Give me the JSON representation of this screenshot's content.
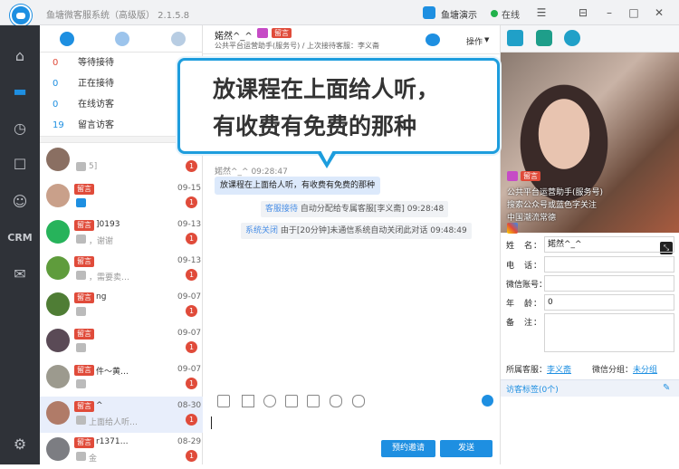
{
  "app": {
    "title": "鱼塘微客服系统（高级版） 2.1.5.8",
    "account": "鱼塘演示",
    "status": "在线"
  },
  "nav": {
    "items": [
      "home-icon",
      "chat-icon",
      "clock-icon",
      "message-icon",
      "user-icon",
      "CRM",
      "mail-icon",
      "settings-icon"
    ]
  },
  "queue": {
    "rows": [
      {
        "count": "0",
        "label": "等待接待"
      },
      {
        "count": "0",
        "label": "正在接待"
      },
      {
        "count": "0",
        "label": "在线访客"
      },
      {
        "count": "19",
        "label": "留言访客"
      }
    ]
  },
  "contacts": [
    {
      "tag": "",
      "name": "",
      "preview": "5]",
      "time": "",
      "badge": "1"
    },
    {
      "tag": "留言",
      "name": "",
      "preview": "",
      "time": "09-15",
      "badge": "1"
    },
    {
      "tag": "留言",
      "name": "]0193",
      "preview": "，谢谢",
      "time": "09-13",
      "badge": "1"
    },
    {
      "tag": "留言",
      "name": "",
      "preview": "，需要卖…",
      "time": "09-13",
      "badge": "1"
    },
    {
      "tag": "留言",
      "name": "ng",
      "preview": "",
      "time": "09-07",
      "badge": "1"
    },
    {
      "tag": "留言",
      "name": "",
      "preview": "",
      "time": "09-07",
      "badge": "1"
    },
    {
      "tag": "留言",
      "name": "件～黄…",
      "preview": "",
      "time": "09-07",
      "badge": "1"
    },
    {
      "tag": "留言",
      "name": "^",
      "preview": "上面给人听…",
      "time": "08-30",
      "badge": "1"
    },
    {
      "tag": "留言",
      "name": "r1371…",
      "preview": "金",
      "time": "08-29",
      "badge": "1"
    }
  ],
  "chat": {
    "customer": "婼然^_^",
    "tag": "留言",
    "subtitle": "公共平台运营助手(服务号) / 上次接待客服：李义斋",
    "operations": "操作",
    "message": {
      "sender": "婼然^_^ 09:28:47",
      "text": "放课程在上面给人听，有收费有免费的那种"
    },
    "system": [
      {
        "key": "客服接待",
        "text": "自动分配给专属客服[李义斋]",
        "time": "09:28:48"
      },
      {
        "key": "系统关闭",
        "text": "由于[20分钟]未通信系统自动关闭此对话",
        "time": "09:48:49"
      }
    ],
    "buttons": {
      "invite": "预约邀请",
      "send": "发送"
    }
  },
  "callout": {
    "line1": "放课程在上面给人听，",
    "line2": "有收费有免费的那种"
  },
  "profile": {
    "photo_tag": "留言",
    "photo_lines": [
      "公共平台运营助手(服务号)",
      "搜索公众号或蓝色字关注",
      "中国潮流常德"
    ],
    "fields": [
      {
        "label": "姓　名：",
        "value": "婼然^_^"
      },
      {
        "label": "电　话：",
        "value": ""
      },
      {
        "label": "微信账号：",
        "value": ""
      },
      {
        "label": "年　龄：",
        "value": "0"
      },
      {
        "label": "备　注：",
        "value": ""
      }
    ],
    "owner_label": "所属客服：",
    "owner": "李义斋",
    "group_label": "微信分组：",
    "group": "未分组",
    "tags_label": "访客标签(0个)"
  }
}
